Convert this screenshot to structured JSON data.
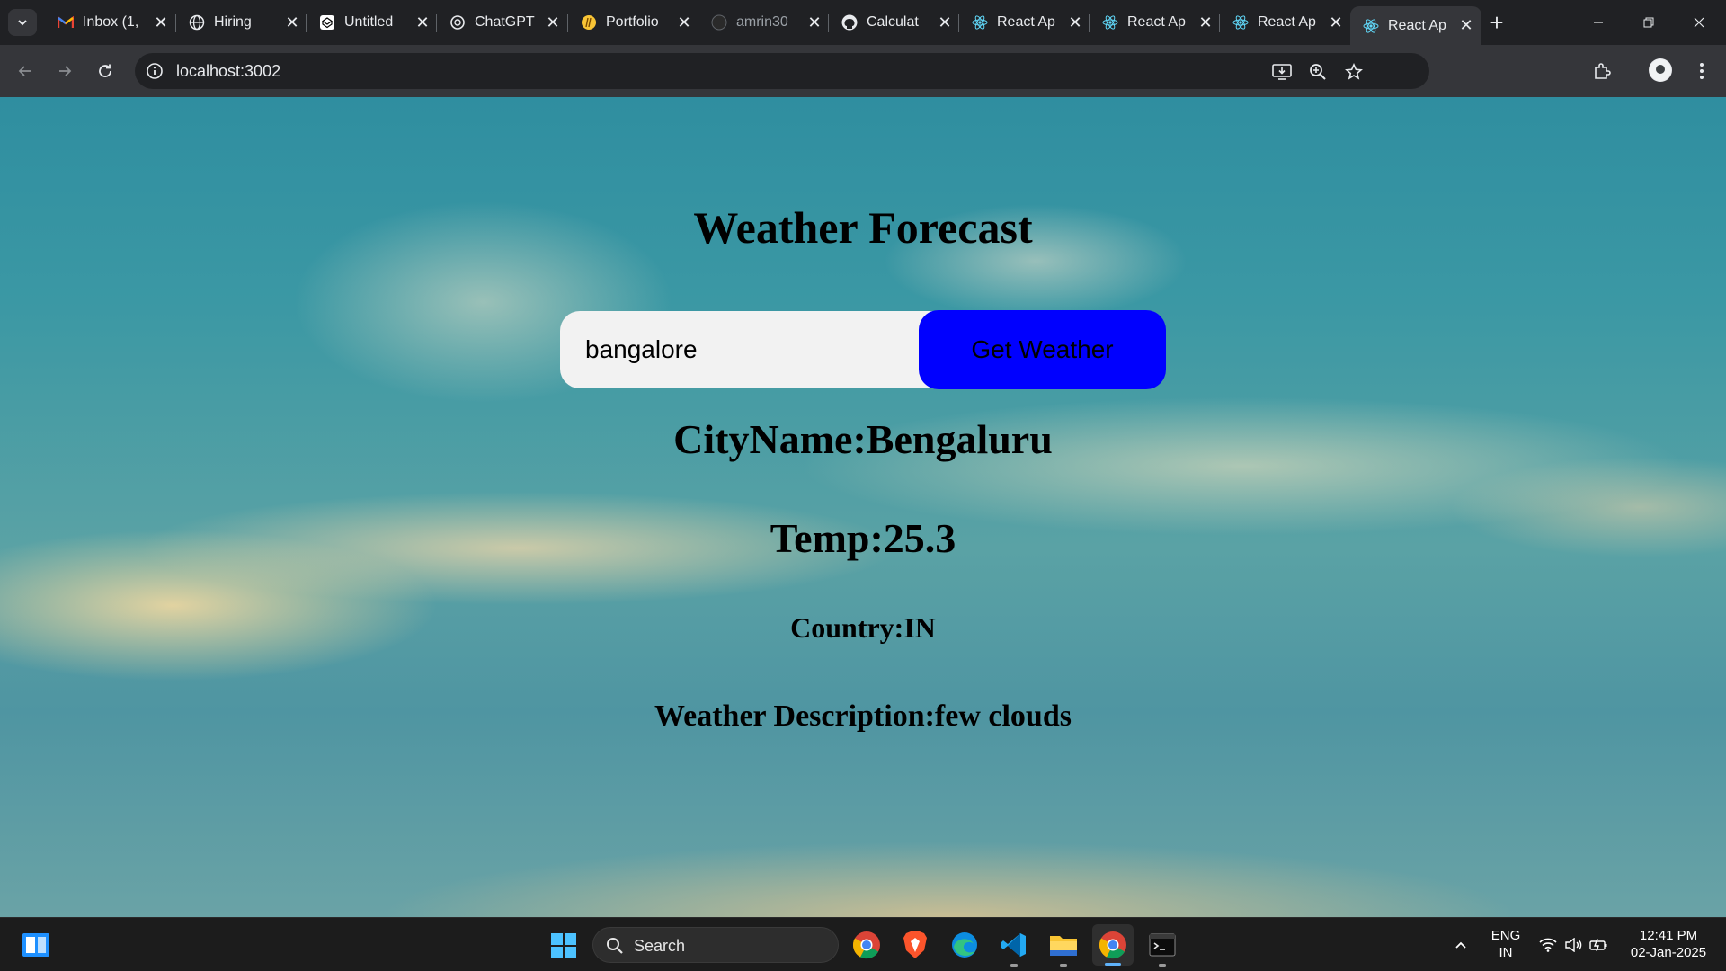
{
  "browser": {
    "tabs": [
      {
        "label": "Inbox (1,",
        "icon": "gmail-icon"
      },
      {
        "label": "Hiring",
        "icon": "globe-icon"
      },
      {
        "label": "Untitled",
        "icon": "codepen-icon"
      },
      {
        "label": "ChatGPT",
        "icon": "chatgpt-icon"
      },
      {
        "label": "Portfolio",
        "icon": "portfolio-icon"
      },
      {
        "label": "amrin30",
        "icon": "github-icon"
      },
      {
        "label": "Calculat",
        "icon": "github-icon"
      },
      {
        "label": "React Ap",
        "icon": "react-icon"
      },
      {
        "label": "React Ap",
        "icon": "react-icon"
      },
      {
        "label": "React Ap",
        "icon": "react-icon"
      },
      {
        "label": "React Ap",
        "icon": "react-icon",
        "active": true
      }
    ],
    "url": "localhost:3002"
  },
  "page": {
    "title": "Weather Forecast",
    "search": {
      "value": "bangalore"
    },
    "button_label": "Get Weather",
    "city": "CityName:Bengaluru",
    "temp": "Temp:25.3",
    "country": "Country:IN",
    "description": "Weather Description:few clouds"
  },
  "taskbar": {
    "search_label": "Search",
    "language": "ENG",
    "region": "IN",
    "time": "12:41 PM",
    "date": "02-Jan-2025"
  },
  "colors": {
    "button_bg": "#0000ff",
    "browser_dark": "#202124",
    "toolbar": "#35363a"
  }
}
